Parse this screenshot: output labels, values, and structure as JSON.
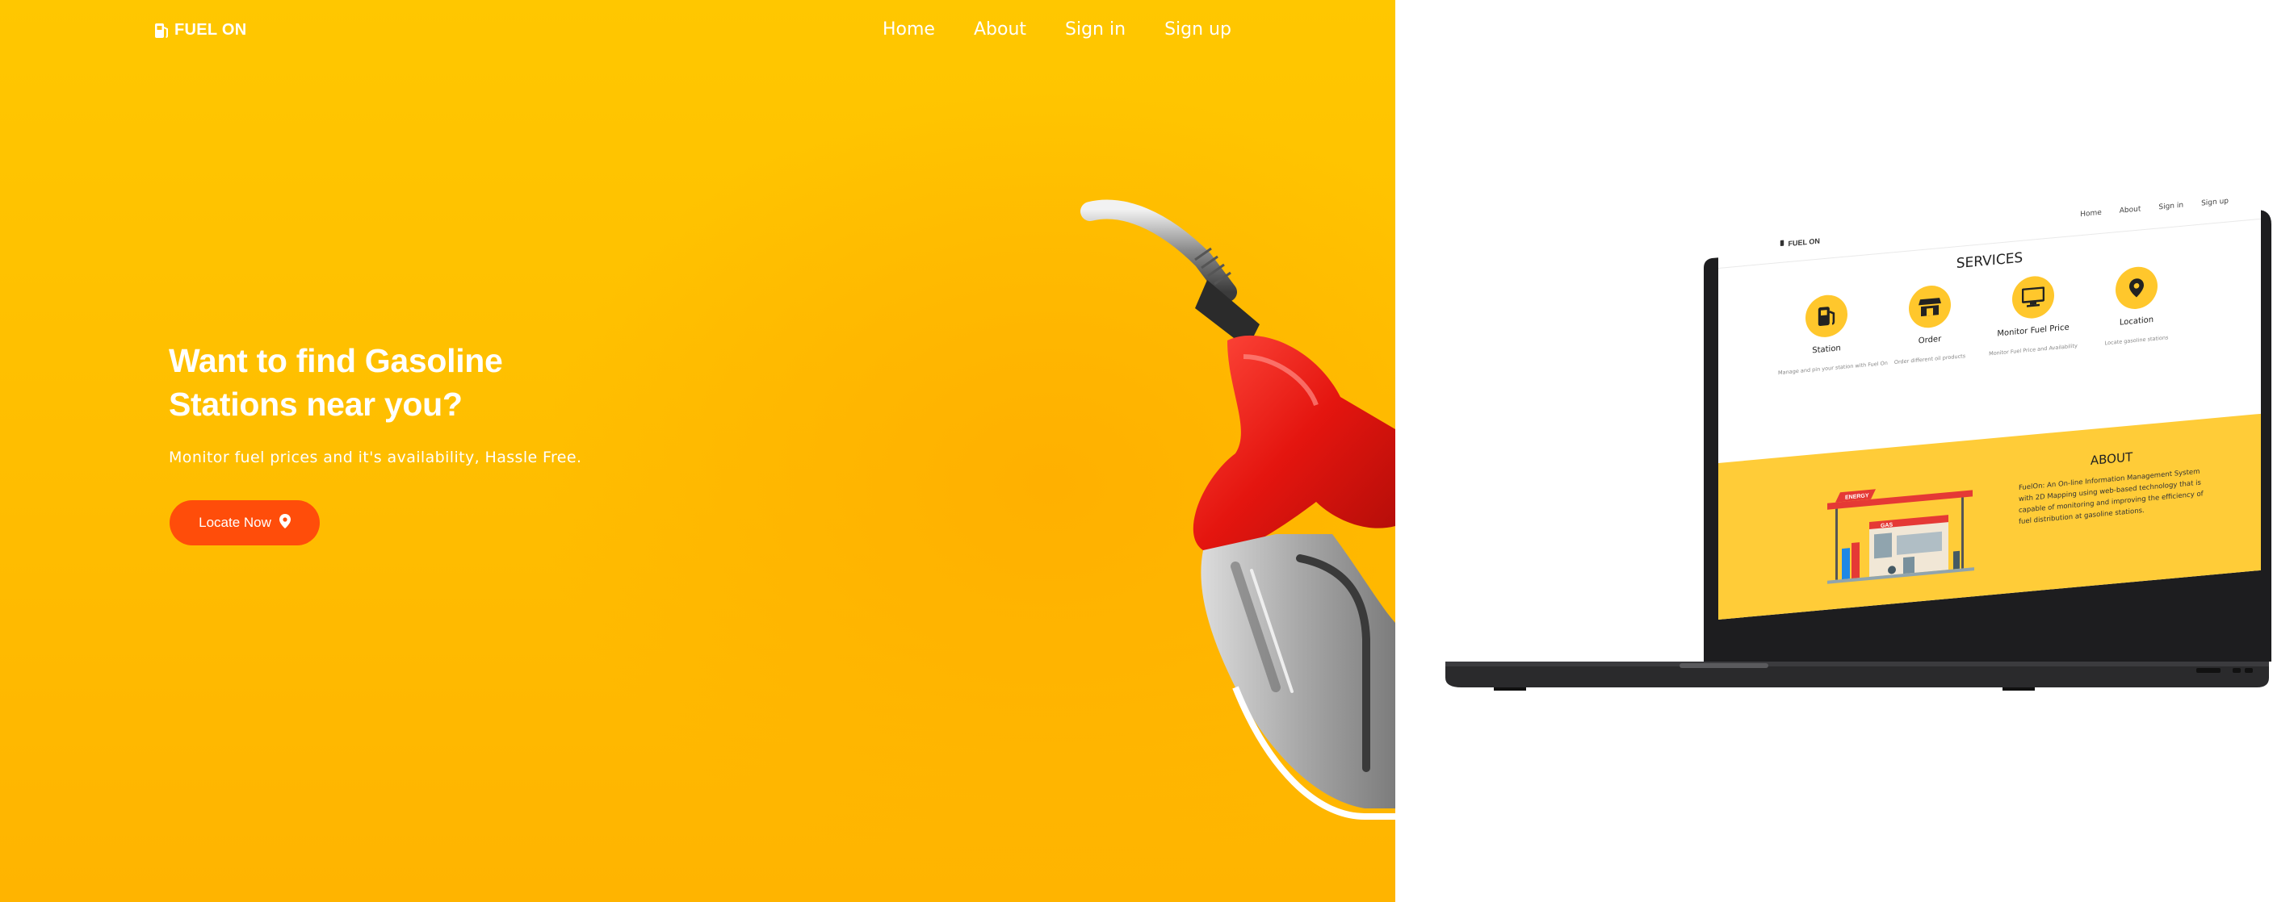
{
  "hero": {
    "logo_text": "FUEL ON",
    "nav": [
      {
        "label": "Home"
      },
      {
        "label": "About"
      },
      {
        "label": "Sign in"
      },
      {
        "label": "Sign up"
      }
    ],
    "headline": "Want to find Gasoline Stations near you?",
    "subtitle": "Monitor fuel prices and it's availability, Hassle Free.",
    "cta_label": "Locate Now",
    "colors": {
      "background": "#ffc107",
      "cta": "#ff4d0a",
      "nozzle": "#e8211a"
    }
  },
  "laptop_preview": {
    "logo_text": "FUEL ON",
    "nav": [
      "Home",
      "About",
      "Sign in",
      "Sign up"
    ],
    "services_title": "SERVICES",
    "services": [
      {
        "label": "Station",
        "desc": "Manage and pin your station with Fuel On",
        "icon": "gas-pump-icon"
      },
      {
        "label": "Order",
        "desc": "Order different oil products",
        "icon": "store-icon"
      },
      {
        "label": "Monitor Fuel Price",
        "desc": "Monitor Fuel Price and Availability",
        "icon": "monitor-icon"
      },
      {
        "label": "Location",
        "desc": "Locate gasoline stations",
        "icon": "location-pin-icon"
      }
    ],
    "about_title": "ABOUT",
    "about_text": "FuelOn: An On-line Information Management System with 2D Mapping using web-based technology that is capable of monitoring and improving the efficiency of fuel distribution at gasoline stations.",
    "station_sign": "ENERGY",
    "station_shop_sign": "GAS",
    "colors": {
      "accent": "#ffc72c",
      "about_bg": "#ffcc38"
    }
  }
}
